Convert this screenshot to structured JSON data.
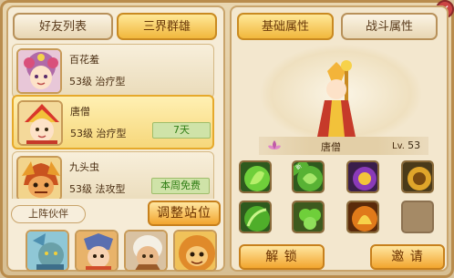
{
  "left": {
    "tabs": [
      {
        "label": "好友列表",
        "active": false
      },
      {
        "label": "三界群雄",
        "active": true
      }
    ],
    "heroes": [
      {
        "name": "百花羞",
        "level": "53级",
        "type": "治疗型",
        "badge": "",
        "selected": false
      },
      {
        "name": "唐僧",
        "level": "53级",
        "type": "治疗型",
        "badge": "7天",
        "selected": true
      },
      {
        "name": "九头虫",
        "level": "53级",
        "type": "法攻型",
        "badge": "本周免费",
        "selected": false
      }
    ],
    "partner_label": "上阵伙伴",
    "adjust_button": "调整站位"
  },
  "right": {
    "tabs": [
      {
        "label": "基础属性",
        "active": true
      },
      {
        "label": "战斗属性",
        "active": false
      }
    ],
    "hero_name": "唐僧",
    "lv_label": "Lv.",
    "lv_value": "53",
    "new_tag": "新",
    "unlock_button": "解 锁",
    "invite_button": "邀 请"
  },
  "colors": {
    "accent": "#f2a52e",
    "frame": "#b98c4d",
    "badge_green": "#2f7d14"
  }
}
